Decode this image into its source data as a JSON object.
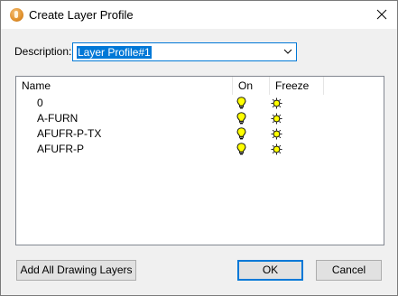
{
  "window": {
    "title": "Create Layer Profile",
    "icon": "app-icon",
    "close_icon": "close-icon"
  },
  "description": {
    "label": "Description:",
    "value": "Layer Profile#1"
  },
  "list": {
    "columns": {
      "name": "Name",
      "on": "On",
      "freeze": "Freeze"
    },
    "rows": [
      {
        "name": "0",
        "on_icon": "lightbulb-on-icon",
        "freeze_icon": "sun-thawed-icon"
      },
      {
        "name": "A-FURN",
        "on_icon": "lightbulb-on-icon",
        "freeze_icon": "sun-thawed-icon"
      },
      {
        "name": "AFUFR-P-TX",
        "on_icon": "lightbulb-on-icon",
        "freeze_icon": "sun-thawed-icon"
      },
      {
        "name": "AFUFR-P",
        "on_icon": "lightbulb-on-icon",
        "freeze_icon": "sun-thawed-icon"
      }
    ]
  },
  "buttons": {
    "add_all": "Add All Drawing Layers",
    "ok": "OK",
    "cancel": "Cancel"
  },
  "colors": {
    "accent": "#0078d7",
    "bulb": "#ffff00",
    "sun": "#ffff00"
  }
}
